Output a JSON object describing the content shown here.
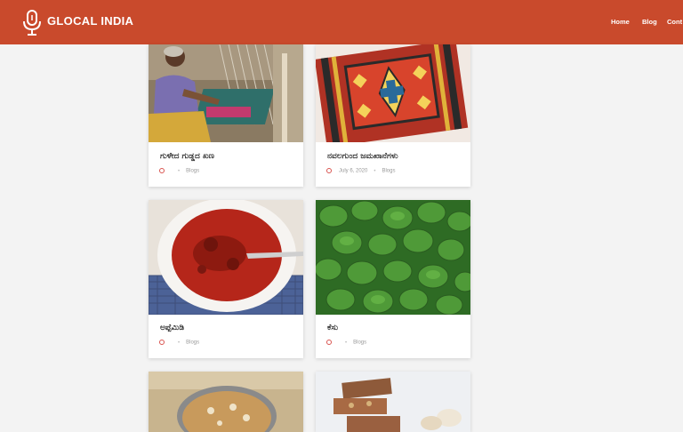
{
  "brand": {
    "name": "GLOCAL INDIA",
    "accent": "#c94a2c"
  },
  "nav": {
    "items": [
      "Home",
      "Blog",
      "Cont"
    ]
  },
  "cards": [
    {
      "title": "ಗುಳೇದ ಗುಡ್ಡದ ಖಣ",
      "date": "",
      "category": "Blogs",
      "image": "woman-weaving-handloom"
    },
    {
      "title": "ನವಲಗುಂದ ಜಮಖಾನೆಗಳು",
      "date": "July 6, 2020",
      "category": "Blogs",
      "image": "woven-carpet-pattern"
    },
    {
      "title": "ಅಪ್ಪೆಮಿಡಿ",
      "date": "",
      "category": "Blogs",
      "image": "red-pickle-bowl"
    },
    {
      "title": "ಕೆಸು",
      "date": "",
      "category": "Blogs",
      "image": "green-leaves"
    },
    {
      "title": "",
      "date": "",
      "category": "",
      "image": "sweet-dish-plate"
    },
    {
      "title": "",
      "date": "",
      "category": "",
      "image": "dry-fruit-sweets"
    }
  ]
}
